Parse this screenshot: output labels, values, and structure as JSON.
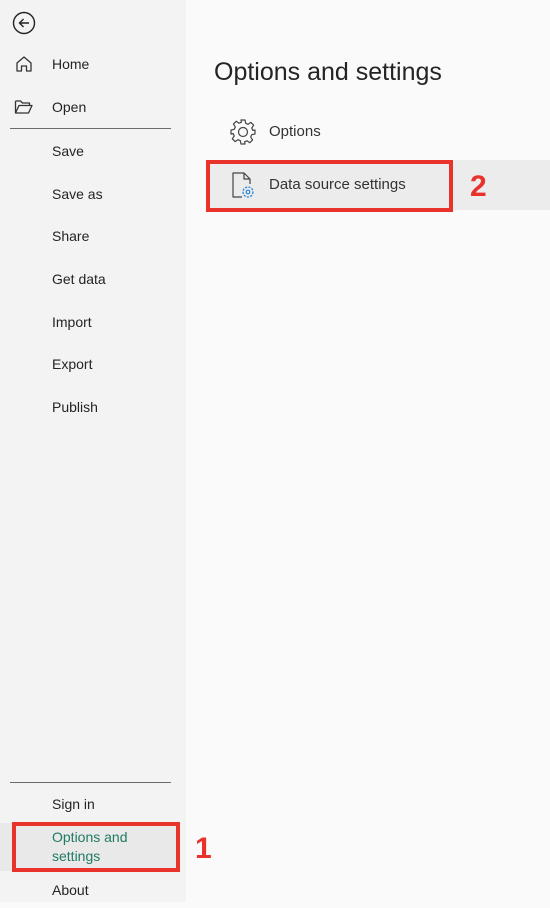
{
  "sidebar": {
    "back_icon": "arrow-left-circle-icon",
    "top_items": [
      {
        "label": "Home",
        "icon": "home-icon"
      },
      {
        "label": "Open",
        "icon": "folder-open-icon"
      }
    ],
    "items": [
      "Save",
      "Save as",
      "Share",
      "Get data",
      "Import",
      "Export",
      "Publish"
    ],
    "bottom_items": [
      "Sign in",
      "Options and settings",
      "About"
    ],
    "selected": "Options and settings",
    "selected_color": "#1f7a63"
  },
  "main": {
    "title": "Options and settings",
    "rows": [
      {
        "label": "Options",
        "icon": "gear-icon"
      },
      {
        "label": "Data source settings",
        "icon": "document-gear-icon"
      }
    ],
    "selected": "Data source settings"
  },
  "annotations": {
    "one": "1",
    "two": "2",
    "color": "#e8322b"
  }
}
